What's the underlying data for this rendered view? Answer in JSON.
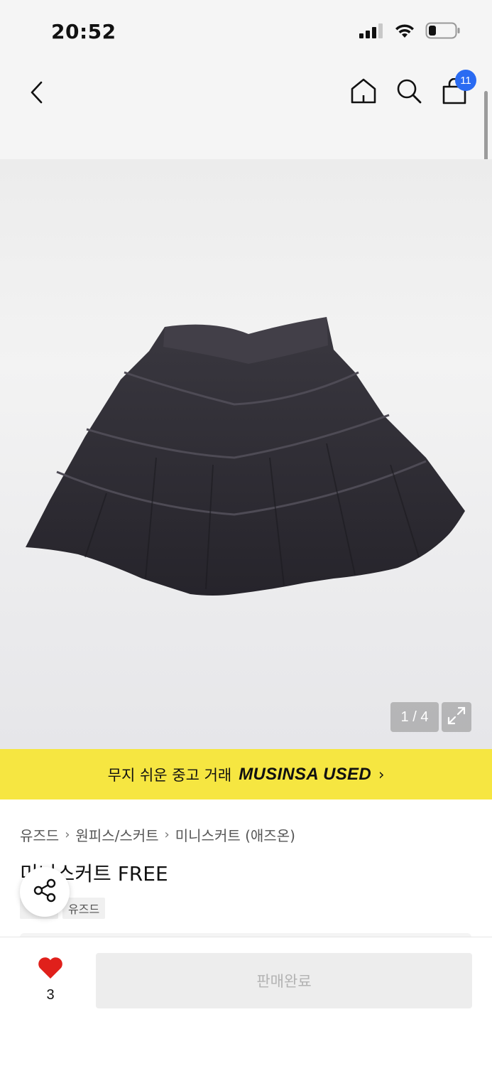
{
  "status_bar": {
    "time": "20:52"
  },
  "header": {
    "cart_count": "11"
  },
  "gallery": {
    "counter": "1 / 4"
  },
  "promo": {
    "text": "무지 쉬운 중고 거래",
    "brand": "MUSINSA USED",
    "arrow": "›"
  },
  "breadcrumb": {
    "items": [
      "유즈드",
      "원피스/스커트",
      "미니스커트 (애즈온)"
    ],
    "separator": "›"
  },
  "product": {
    "title": "미니스커트 FREE",
    "tags": [
      "",
      "유즈드"
    ]
  },
  "bottom_bar": {
    "like_count": "3",
    "buy_label": "판매완료"
  },
  "colors": {
    "promo_bg": "#f6e641",
    "badge": "#2a6bf2",
    "heart": "#e0201b",
    "skirt": "#2d2b33"
  },
  "icons": [
    "back-arrow-icon",
    "home-icon",
    "search-icon",
    "shopping-bag-icon",
    "expand-icon",
    "share-icon",
    "heart-icon",
    "signal-icon",
    "wifi-icon",
    "battery-icon"
  ]
}
